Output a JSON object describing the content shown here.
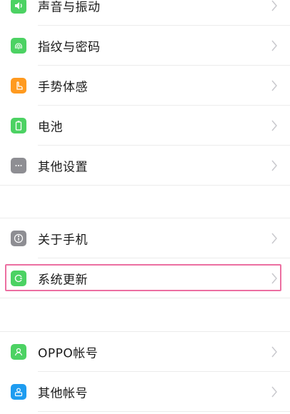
{
  "settings": {
    "items": [
      {
        "label": "声音与振动",
        "icon": "speaker-icon",
        "color": "#4cd263"
      },
      {
        "label": "指纹与密码",
        "icon": "fingerprint-icon",
        "color": "#4cd263"
      },
      {
        "label": "手势体感",
        "icon": "hand-gesture-icon",
        "color": "#ff9a1f"
      },
      {
        "label": "电池",
        "icon": "battery-icon",
        "color": "#4cd263"
      },
      {
        "label": "其他设置",
        "icon": "more-dots-icon",
        "color": "#8e8e93"
      },
      {
        "label": "关于手机",
        "icon": "info-icon",
        "color": "#8e8e93"
      },
      {
        "label": "系统更新",
        "icon": "system-update-icon",
        "color": "#4cd263"
      },
      {
        "label": "OPPO帐号",
        "icon": "account-person-icon",
        "color": "#4cd263"
      },
      {
        "label": "其他帐号",
        "icon": "other-accounts-icon",
        "color": "#1e9cf0"
      }
    ]
  },
  "highlight_color": "#ec6fa1"
}
